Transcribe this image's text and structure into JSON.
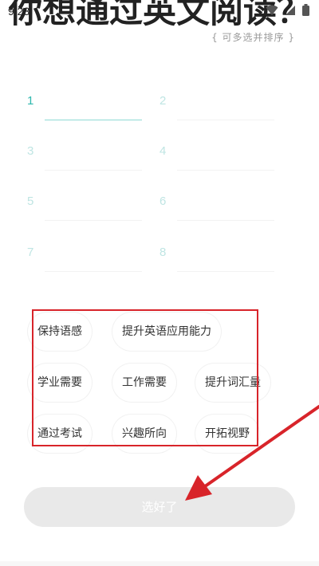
{
  "status_bar": {
    "time": "9:23",
    "icons": [
      "wifi-icon",
      "signal-icon",
      "battery-icon"
    ]
  },
  "header": {
    "title": "你想通过英文阅读？",
    "hint": "{ 可多选并排序 }"
  },
  "ranking_slots": [
    {
      "number": "1",
      "active": true
    },
    {
      "number": "2",
      "active": false
    },
    {
      "number": "3",
      "active": false
    },
    {
      "number": "4",
      "active": false
    },
    {
      "number": "5",
      "active": false
    },
    {
      "number": "6",
      "active": false
    },
    {
      "number": "7",
      "active": false
    },
    {
      "number": "8",
      "active": false
    }
  ],
  "options": [
    "保持语感",
    "提升英语应用能力",
    "学业需要",
    "工作需要",
    "提升词汇量",
    "通过考试",
    "兴趣所向",
    "开拓视野"
  ],
  "confirm_button": {
    "label": "选好了"
  },
  "colors": {
    "accent": "#2fb8ae",
    "annotation_red": "#d8242a",
    "button_disabled": "#e9e9e9"
  }
}
